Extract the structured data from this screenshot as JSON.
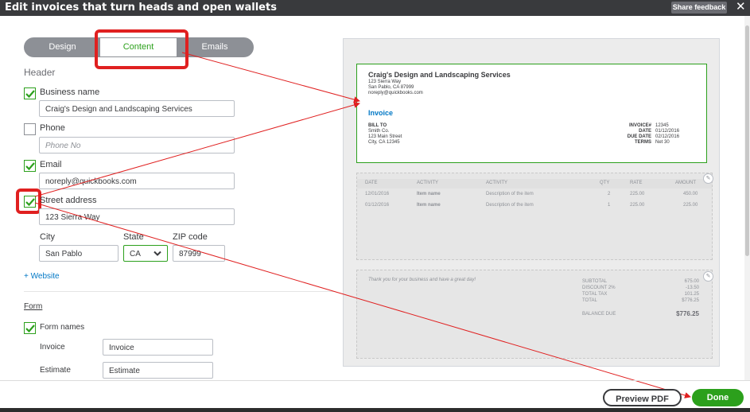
{
  "window": {
    "title": "Edit invoices that turn heads and open wallets",
    "feedback_label": "Share feedback",
    "close_glyph": "✕"
  },
  "tabs": {
    "design": "Design",
    "content": "Content",
    "emails": "Emails"
  },
  "header_section": {
    "title": "Header",
    "business_name": {
      "label": "Business name",
      "checked": true,
      "value": "Craig's Design and Landscaping Services"
    },
    "phone": {
      "label": "Phone",
      "checked": false,
      "placeholder": "Phone No"
    },
    "email": {
      "label": "Email",
      "checked": true,
      "value": "noreply@quickbooks.com"
    },
    "street": {
      "label": "Street address",
      "checked": true,
      "value": "123 Sierra Way"
    },
    "city": {
      "label": "City",
      "value": "San Pablo"
    },
    "state": {
      "label": "State",
      "value": "CA"
    },
    "zip": {
      "label": "ZIP code",
      "value": "87999"
    },
    "website_link": "+ Website"
  },
  "form_section": {
    "title": "Form",
    "form_names": {
      "label": "Form names",
      "checked": true
    },
    "invoice": {
      "label": "Invoice",
      "value": "Invoice"
    },
    "estimate": {
      "label": "Estimate",
      "value": "Estimate"
    }
  },
  "preview": {
    "company": "Craig's Design and Landscaping Services",
    "addr1": "123 Sierra Way",
    "addr2": "San Pablo, CA 87999",
    "email": "noreply@quickbooks.com",
    "doc_title": "Invoice",
    "bill_to_label": "BILL TO",
    "bill_to": [
      "Smith Co.",
      "123 Main Street",
      "City, CA 12345"
    ],
    "meta": [
      {
        "k": "INVOICE#",
        "v": "12345"
      },
      {
        "k": "DATE",
        "v": "01/12/2016"
      },
      {
        "k": "DUE DATE",
        "v": "02/12/2016"
      },
      {
        "k": "TERMS",
        "v": "Net 30"
      }
    ],
    "table_headers": [
      "DATE",
      "ACTIVITY",
      "ACTIVITY",
      "QTY",
      "RATE",
      "AMOUNT"
    ],
    "rows": [
      [
        "12/01/2016",
        "Item name",
        "Description of the item",
        "2",
        "225.00",
        "450.00"
      ],
      [
        "01/12/2016",
        "Item name",
        "Description of the item",
        "1",
        "225.00",
        "225.00"
      ]
    ],
    "thanks": "Thank you for your business and have a great day!",
    "totals": [
      {
        "k": "SUBTOTAL",
        "v": "675.00"
      },
      {
        "k": "DISCOUNT 2%",
        "v": "-13.50"
      },
      {
        "k": "TOTAL TAX",
        "v": "101.25"
      },
      {
        "k": "TOTAL",
        "v": "$776.25"
      }
    ],
    "balance_label": "BALANCE DUE",
    "balance_value": "$776.25"
  },
  "footer": {
    "preview_pdf": "Preview PDF",
    "done": "Done"
  },
  "colors": {
    "accent": "#2ca01c",
    "highlight": "#e02020",
    "link": "#0077c5"
  }
}
